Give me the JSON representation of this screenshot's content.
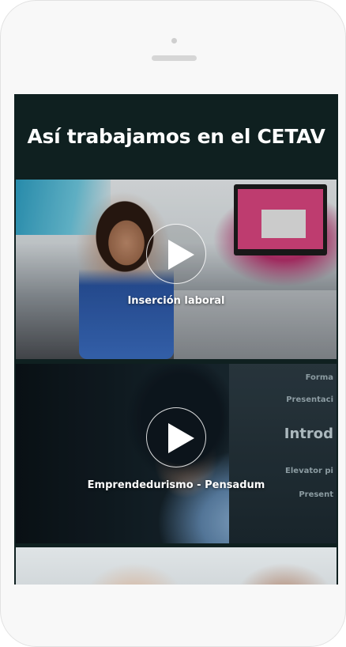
{
  "page": {
    "title": "Así trabajamos en el CETAV"
  },
  "videos": [
    {
      "caption": "Inserción laboral",
      "icon": "play-icon"
    },
    {
      "caption": "Emprendedurismo - Pensadum",
      "icon": "play-icon"
    },
    {
      "caption": "",
      "icon": ""
    }
  ],
  "slide_text": {
    "line1": "Forma",
    "line2": "Presentaci",
    "line3": "Introd",
    "line4": "Elevator pi",
    "line5": "Present"
  },
  "colors": {
    "header_bg": "#0f2020",
    "title_text": "#ffffff",
    "device_frame": "#f8f8f8"
  }
}
